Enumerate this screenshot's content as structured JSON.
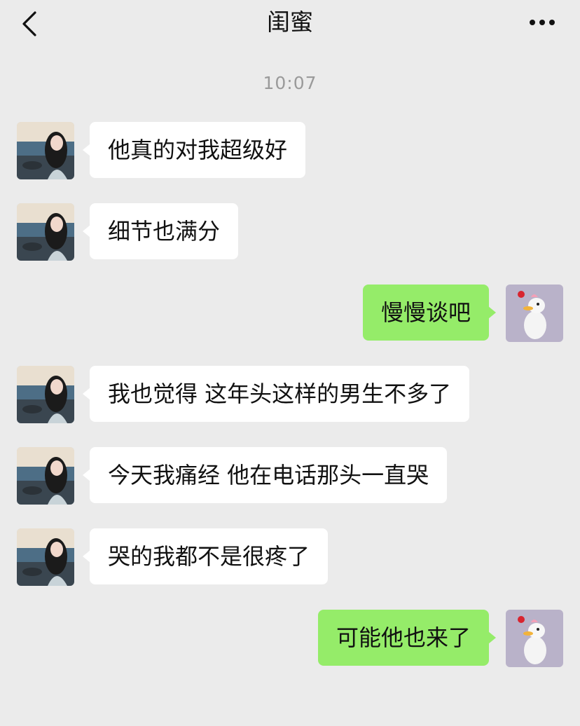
{
  "header": {
    "title": "闺蜜",
    "back_icon": "chevron-left-icon",
    "more_icon": "more-dots-icon"
  },
  "timestamp": "10:07",
  "messages": [
    {
      "side": "left",
      "text": "他真的对我超级好"
    },
    {
      "side": "left",
      "text": "细节也满分"
    },
    {
      "side": "right",
      "text": "慢慢谈吧"
    },
    {
      "side": "left",
      "text": "我也觉得 这年头这样的男生不多了"
    },
    {
      "side": "left",
      "text": "今天我痛经  他在电话那头一直哭"
    },
    {
      "side": "left",
      "text": "哭的我都不是很疼了"
    },
    {
      "side": "right",
      "text": "可能他也来了"
    }
  ],
  "colors": {
    "background": "#ebebeb",
    "incoming_bubble": "#ffffff",
    "outgoing_bubble": "#95ec69",
    "timestamp": "#9a9a9a"
  }
}
